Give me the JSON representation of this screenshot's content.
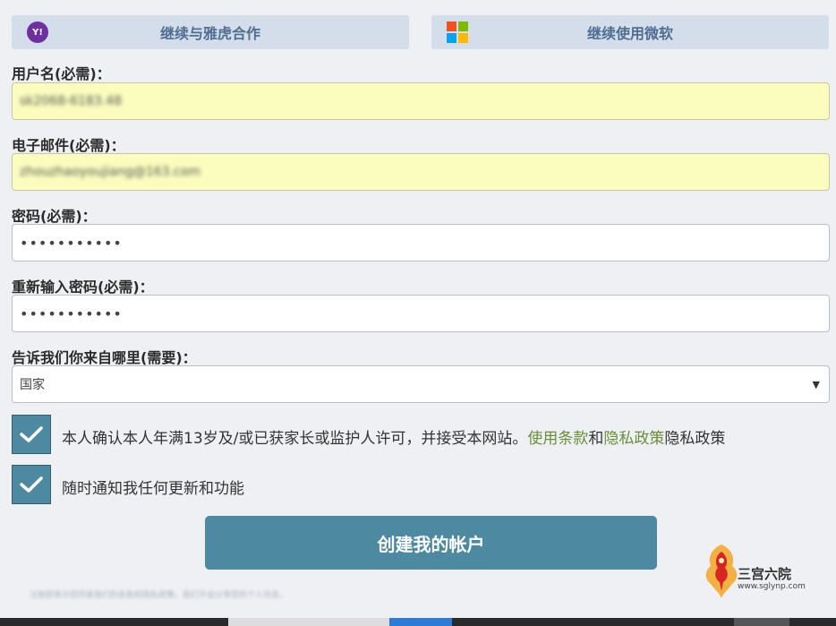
{
  "social": {
    "yahoo_label": "继续与雅虎合作",
    "yahoo_icon_text": "Y!",
    "microsoft_label": "继续使用微软",
    "microsoft_colors": [
      "#f25022",
      "#7fba00",
      "#00a4ef",
      "#ffb900"
    ]
  },
  "form": {
    "username_label": "用户名(必需)：",
    "username_value": "sk2068-6183.48",
    "email_label": "电子邮件(必需)：",
    "email_value": "zhouzhaoyoujiang@163.com",
    "password_label": "密码(必需)：",
    "password_value": "•••••••••••",
    "confirm_label": "重新输入密码(必需)：",
    "confirm_value": "•••••••••••",
    "country_label": "告诉我们你来自哪里(需要)：",
    "country_value": "国家",
    "consent_text_before": "本人确认本人年满13岁及/或已获家长或监护人许可，并接受本网站。",
    "terms_link": "使用条款",
    "and_text": "和",
    "privacy_link": "隐私政策",
    "consent_text_after": "隐私政策",
    "notify_text": "随时通知我任何更新和功能",
    "submit_label": "创建我的帐户"
  },
  "footer": {
    "blurred_text": "注册即表示您同意我们的条款和隐私政策。我们不会分享您的个人信息。"
  },
  "watermark": {
    "name": "三宫六院",
    "url": "www.sglynp.com"
  },
  "colors": {
    "accent": "#4d8aa1",
    "social_bg": "#d3deea",
    "autofill_bg": "#fafdbd",
    "link": "#6b8e3a"
  }
}
